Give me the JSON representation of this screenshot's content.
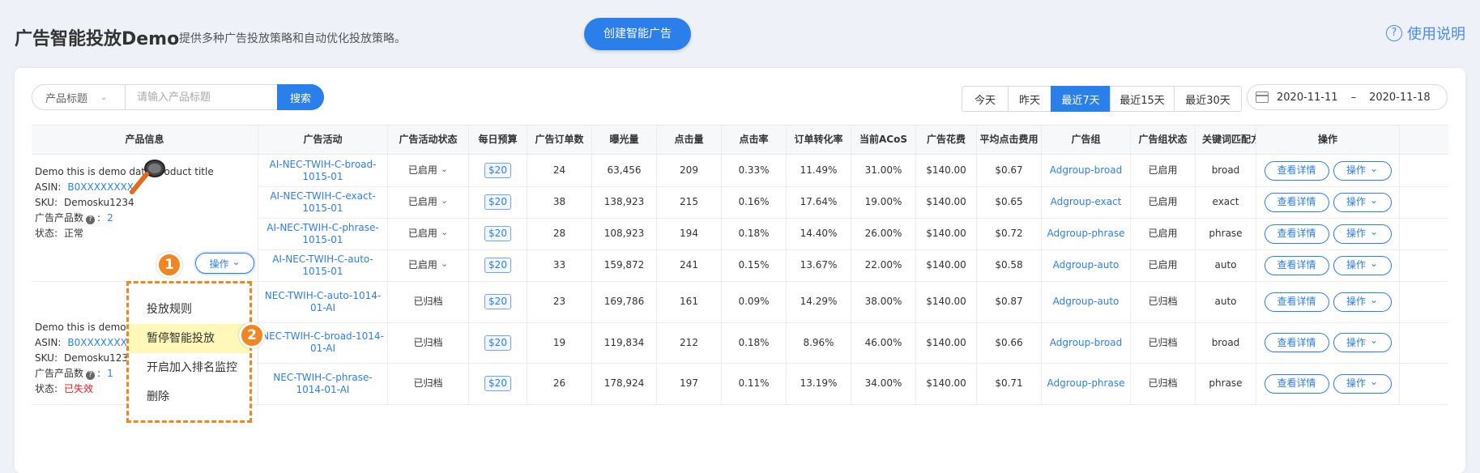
{
  "header": {
    "title": "广告智能投放Demo",
    "subtitle": "提供多种广告投放策略和自动优化投放策略。",
    "create_label": "创建智能广告",
    "help_label": "使用说明"
  },
  "search": {
    "select_label": "产品标题",
    "placeholder": "请输入产品标题",
    "button": "搜索"
  },
  "date_tabs": [
    "今天",
    "昨天",
    "最近7天",
    "最近15天",
    "最近30天"
  ],
  "date_active": "最近7天",
  "date_range": {
    "start": "2020-11-11",
    "sep": "–",
    "end": "2020-11-18"
  },
  "columns": [
    "产品信息",
    "广告活动",
    "广告活动状态",
    "每日预算",
    "广告订单数",
    "曝光量",
    "点击量",
    "点击率",
    "订单转化率",
    "当前ACoS",
    "广告花费",
    "平均点击费用",
    "广告组",
    "广告组状态",
    "关键词匹配方",
    "操作"
  ],
  "products": [
    {
      "title": "Demo this is demo data product title",
      "asin_label": "ASIN:",
      "asin": "B0XXXXXXXX",
      "sku_label": "SKU:",
      "sku": "Demosku1234",
      "count_label": "广告产品数",
      "count": "2",
      "status_label": "状态:",
      "status": "正常",
      "op": "操作"
    },
    {
      "title": "Demo this is demo da",
      "asin_label": "ASIN:",
      "asin": "B0XXXXXXX",
      "sku_label": "SKU:",
      "sku": "Demosku1234",
      "count_label": "广告产品数",
      "count": "1",
      "status_label": "状态:",
      "status": "已失效"
    }
  ],
  "rows": [
    {
      "campaign": "AI-NEC-TWIH-C-broad-1015-01",
      "status": "已启用",
      "budget": "$20",
      "orders": "24",
      "impr": "63,456",
      "clicks": "209",
      "ctr": "0.33%",
      "cvr": "11.49%",
      "acos": "31.00%",
      "spend": "$140.00",
      "cpc": "$0.67",
      "group": "Adgroup-broad",
      "gstatus": "已启用",
      "match": "broad",
      "detail": "查看详情",
      "op": "操作"
    },
    {
      "campaign": "AI-NEC-TWIH-C-exact-1015-01",
      "status": "已启用",
      "budget": "$20",
      "orders": "38",
      "impr": "138,923",
      "clicks": "215",
      "ctr": "0.16%",
      "cvr": "17.64%",
      "acos": "19.00%",
      "spend": "$140.00",
      "cpc": "$0.65",
      "group": "Adgroup-exact",
      "gstatus": "已启用",
      "match": "exact",
      "detail": "查看详情",
      "op": "操作"
    },
    {
      "campaign": "AI-NEC-TWIH-C-phrase-1015-01",
      "status": "已启用",
      "budget": "$20",
      "orders": "28",
      "impr": "108,923",
      "clicks": "194",
      "ctr": "0.18%",
      "cvr": "14.40%",
      "acos": "26.00%",
      "spend": "$140.00",
      "cpc": "$0.72",
      "group": "Adgroup-phrase",
      "gstatus": "已启用",
      "match": "phrase",
      "detail": "查看详情",
      "op": "操作"
    },
    {
      "campaign": "AI-NEC-TWIH-C-auto-1015-01",
      "status": "已启用",
      "budget": "$20",
      "orders": "33",
      "impr": "159,872",
      "clicks": "241",
      "ctr": "0.15%",
      "cvr": "13.67%",
      "acos": "22.00%",
      "spend": "$140.00",
      "cpc": "$0.58",
      "group": "Adgroup-auto",
      "gstatus": "已启用",
      "match": "auto",
      "detail": "查看详情",
      "op": "操作"
    },
    {
      "campaign": "NEC-TWIH-C-auto-1014-01-AI",
      "status": "已归档",
      "budget": "$20",
      "orders": "23",
      "impr": "169,786",
      "clicks": "161",
      "ctr": "0.09%",
      "cvr": "14.29%",
      "acos": "38.00%",
      "spend": "$140.00",
      "cpc": "$0.87",
      "group": "Adgroup-auto",
      "gstatus": "已归档",
      "match": "auto",
      "detail": "查看详情",
      "op": "操作"
    },
    {
      "campaign": "NEC-TWIH-C-broad-1014-01-AI",
      "status": "已归档",
      "budget": "$20",
      "orders": "19",
      "impr": "119,834",
      "clicks": "212",
      "ctr": "0.18%",
      "cvr": "8.96%",
      "acos": "46.00%",
      "spend": "$140.00",
      "cpc": "$0.66",
      "group": "Adgroup-broad",
      "gstatus": "已归档",
      "match": "broad",
      "detail": "查看详情",
      "op": "操作"
    },
    {
      "campaign": "NEC-TWIH-C-phrase-1014-01-AI",
      "status": "已归档",
      "budget": "$20",
      "orders": "26",
      "impr": "178,924",
      "clicks": "197",
      "ctr": "0.11%",
      "cvr": "13.19%",
      "acos": "34.00%",
      "spend": "$140.00",
      "cpc": "$0.71",
      "group": "Adgroup-phrase",
      "gstatus": "已归档",
      "match": "phrase",
      "detail": "查看详情",
      "op": "操作"
    }
  ],
  "menu": {
    "items": [
      "投放规则",
      "暂停智能投放",
      "开启加入排名监控",
      "删除"
    ],
    "highlight": "暂停智能投放"
  },
  "badges": [
    "1",
    "2"
  ],
  "colors": {
    "primary": "#2b7fea",
    "annotation": "#f08522",
    "highlight": "#fff8b8",
    "danger": "#e81b1b"
  }
}
